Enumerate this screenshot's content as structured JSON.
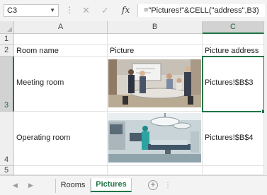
{
  "formula_bar": {
    "name_box": "C3",
    "cancel_icon": "✕",
    "enter_icon": "✓",
    "function_label": "fx",
    "formula": "=\"Pictures!\"&CELL(\"address\",B3)"
  },
  "columns": [
    "A",
    "B",
    "C"
  ],
  "rows": [
    "1",
    "2",
    "3",
    "4",
    "5"
  ],
  "cells": {
    "A2": "Room name",
    "B2": "Picture",
    "C2": "Picture address",
    "A3": "Meeting room",
    "C3": "Pictures!$B$3",
    "A4": "Operating room",
    "C4": "Pictures!$B$4"
  },
  "pictures": {
    "B3": "meeting-room-photo",
    "B4": "operating-room-photo"
  },
  "sheet_tabs": {
    "tabs": [
      "Rooms",
      "Pictures"
    ],
    "active": "Pictures",
    "add_icon": "+"
  },
  "colors": {
    "accent": "#217346"
  }
}
